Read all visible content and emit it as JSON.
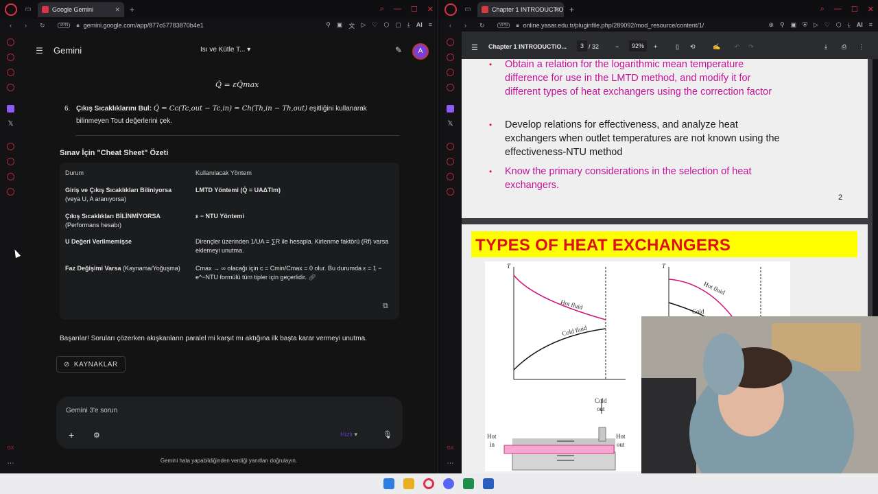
{
  "left_browser": {
    "tab_title": "Google Gemini",
    "vpn_label": "VPN",
    "url": "gemini.google.com/app/877c67783870b4e1",
    "ai_label": "AI"
  },
  "gemini": {
    "app_title": "Gemini",
    "chat_title": "Isı ve Kütle T...",
    "avatar_letter": "A",
    "formula_top": "Q̇ = εQ̇max",
    "step6": {
      "number": "6.",
      "bold": "Çıkış Sıcaklıklarını Bul:",
      "formula": "Q̇ = Cc(Tc,out − Tc,in) = Ch(Th,in − Th,out)",
      "rest": "eşitliğini kullanarak",
      "line2": "bilinmeyen Tout değerlerini çek."
    },
    "cheat_sheet_title": "Sınav İçin \"Cheat Sheet\" Özeti",
    "table": {
      "headers": [
        "Durum",
        "Kullanılacak Yöntem"
      ],
      "rows": [
        {
          "durum_bold": "Giriş ve Çıkış Sıcaklıkları Biliniyorsa",
          "durum_rest": "(veya U, A aranıyorsa)",
          "yontem": "LMTD Yöntemi (Q̇ = UAΔTlm)"
        },
        {
          "durum_bold": "Çıkış Sıcaklıkları BİLİNMİYORSA",
          "durum_rest": "(Performans hesabı)",
          "yontem": "ε − NTU Yöntemi"
        },
        {
          "durum_bold": "U Değeri Verilmemişse",
          "durum_rest": "",
          "yontem": "Dirençler üzerinden 1/UA = ∑R ile hesapla. Kirlenme faktörü (Rf) varsa eklemeyi unutma."
        },
        {
          "durum_bold": "Faz Değişimi Varsa",
          "durum_rest": "(Kaynama/Yoğuşma)",
          "yontem": "Cmax → ∞ olacağı için c = Cmin/Cmax = 0 olur. Bu durumda ε = 1 − e^−NTU formülü tüm tipler için geçerlidir."
        }
      ]
    },
    "closing_text": "Başarılar! Soruları çözerken akışkanların paralel mi karşıt mı aktığına ilk başta karar vermeyi unutma.",
    "sources_label": "KAYNAKLAR",
    "input_placeholder": "Gemini 3'e sorun",
    "mode_label": "Hızlı",
    "disclaimer": "Gemini hata yapabildiğinden verdiği yanıtları doğrulayın."
  },
  "right_browser": {
    "tab_title": "Chapter 1 INTRODUCTIO",
    "vpn_label": "VPN",
    "url": "online.yasar.edu.tr/pluginfile.php/289092/mod_resource/content/1/",
    "ai_label": "AI"
  },
  "pdf": {
    "doc_title": "Chapter 1 INTRODUCTIO...",
    "current_page": "3",
    "total_pages": "/ 32",
    "zoom": "92%",
    "bullets": [
      {
        "text": "Obtain a relation for the logarithmic mean temperature difference for use in the LMTD method, and modify it for different types of heat exchangers using the correction factor",
        "color": "#c0149a"
      },
      {
        "text": "Develop relations for effectiveness, and analyze heat exchangers when outlet temperatures are not known using the effectiveness-NTU method",
        "color": "#1a1a1a"
      },
      {
        "text": "Know the primary considerations in the selection of heat exchangers.",
        "color": "#c0149a"
      }
    ],
    "page_number": "2",
    "section_title": "TYPES OF HEAT EXCHANGERS",
    "figure": {
      "axis_t_left": "T",
      "axis_t_right": "T",
      "hot_fluid": "Hot fluid",
      "cold_fluid": "Cold fluid",
      "hot_fluid_right": "Hot fluid",
      "cold_partial": "Cold",
      "cold_out_1": "Cold",
      "cold_out_2": "out",
      "hot_in_1": "Hot",
      "hot_in_2": "in",
      "hot_out_1": "Hot",
      "hot_out_2": "out"
    }
  },
  "colors": {
    "accent_red": "#e0304a",
    "pdf_magenta": "#c0149a",
    "types_yellow": "#ffff00",
    "types_red": "#e0101a"
  }
}
